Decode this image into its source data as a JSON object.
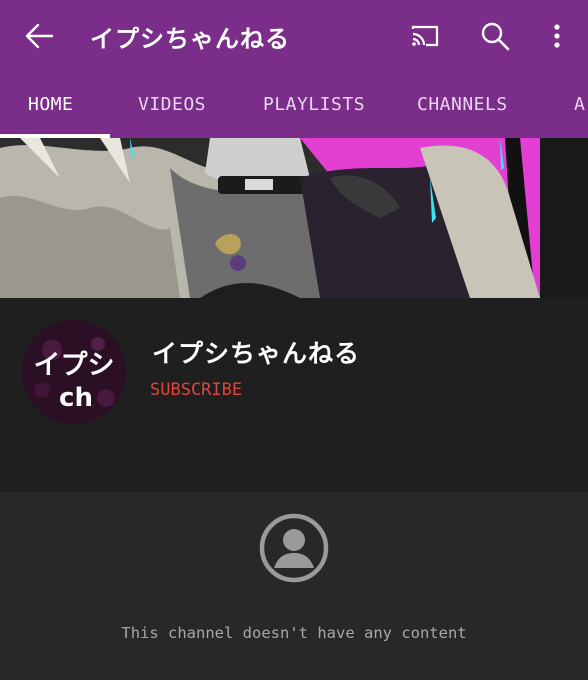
{
  "header": {
    "title": "イプシちゃんねる",
    "back_icon": "arrow-left-icon",
    "cast_icon": "cast-icon",
    "search_icon": "search-icon",
    "more_icon": "more-vert-icon",
    "accent_color": "#7b2d8a"
  },
  "tabs": [
    {
      "label": "HOME",
      "active": true
    },
    {
      "label": "VIDEOS",
      "active": false
    },
    {
      "label": "PLAYLISTS",
      "active": false
    },
    {
      "label": "CHANNELS",
      "active": false
    },
    {
      "label": "A",
      "active": false
    }
  ],
  "channel": {
    "name": "イプシちゃんねる",
    "subscribe_label": "SUBSCRIBE",
    "subscribe_color": "#e0453b",
    "avatar_text_line1": "イプシ",
    "avatar_text_line2": "ch"
  },
  "empty_state": {
    "icon": "account-circle-icon",
    "message": "This channel doesn't have any content"
  }
}
